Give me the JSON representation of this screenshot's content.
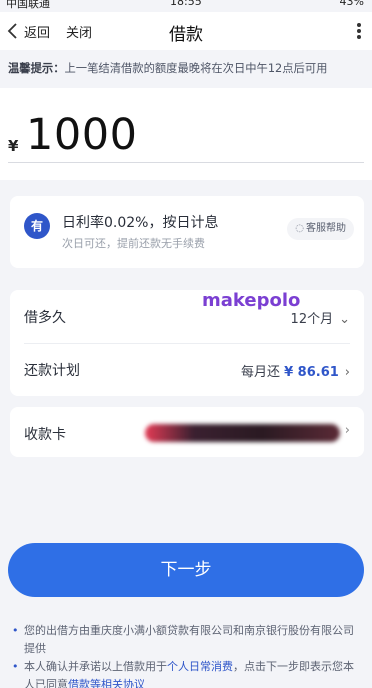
{
  "status_bar": {
    "carrier": "中国联通",
    "time": "18:55",
    "battery": "43%"
  },
  "nav": {
    "back_label": "返回",
    "close_label": "关闭",
    "title": "借款"
  },
  "tip": {
    "label": "温馨提示：",
    "text": "上一笔结清借款的额度最晚将在次日中午12点后可用"
  },
  "amount": {
    "currency": "¥",
    "value": "1000"
  },
  "rate": {
    "logo_text": "有",
    "main": "日利率0.02%，按日计息",
    "sub": "次日可还，提前还款无手续费",
    "help_label": "客服帮助"
  },
  "loan": {
    "term_label": "借多久",
    "term_value": "12个月",
    "plan_label": "还款计划",
    "plan_prefix": "每月还",
    "plan_amount": "¥ 86.61"
  },
  "card": {
    "label": "收款卡"
  },
  "watermark": "makepolo",
  "next_button": "下一步",
  "notes": {
    "n1": "您的出借方由重庆度小满小额贷款有限公司和南京银行股份有限公司提供",
    "n2_prefix": "本人确认并承诺以上借款用于",
    "n2_link": "个人日常消费",
    "n2_suffix": "，点击下一步即表示您本人已同意",
    "n2_link2": "借款等相关协议"
  },
  "colors": {
    "accent": "#2f6fe6",
    "brand_blue": "#2f56c9",
    "watermark": "#7b3fd2"
  }
}
